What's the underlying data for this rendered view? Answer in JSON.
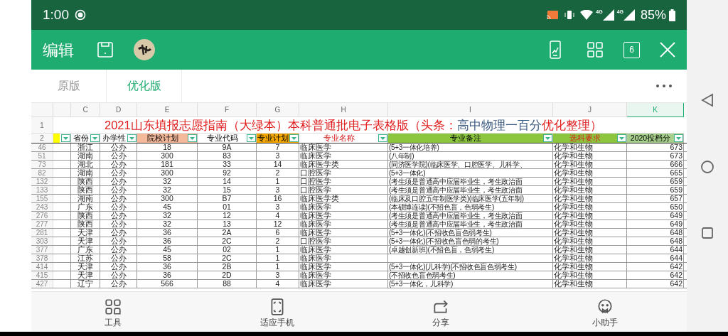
{
  "status_bar": {
    "time": "1:00",
    "network": [
      "4G",
      "4G"
    ],
    "battery": "85%"
  },
  "toolbar": {
    "title": "编辑",
    "page_count": "6"
  },
  "tabs": [
    {
      "label": "原版",
      "selected": false
    },
    {
      "label": "优化版",
      "selected": true
    }
  ],
  "sheet": {
    "columns": [
      {
        "label": "C",
        "selected": false
      },
      {
        "label": "D",
        "selected": false
      },
      {
        "label": "E",
        "selected": false
      },
      {
        "label": "F",
        "selected": false
      },
      {
        "label": "G",
        "selected": false
      },
      {
        "label": "H",
        "selected": false
      },
      {
        "label": "I",
        "selected": false
      },
      {
        "label": "J",
        "selected": false
      },
      {
        "label": "K",
        "selected": true
      }
    ],
    "title_row": "1",
    "title_parts": [
      {
        "text": "2021山东填报志愿指南（大绿本）本科普通批电子表格版（头条：",
        "color": "#e02020"
      },
      {
        "text": "高中物理一百分",
        "color": "#3a5a80"
      },
      {
        "text": "优化整理）",
        "color": "#e02020"
      }
    ],
    "header_row": "2",
    "headers": [
      {
        "color": "#ffff00",
        "kind": "plain"
      },
      {
        "text": "省份",
        "color": "#ffffff",
        "kind": "plain"
      },
      {
        "text": "办学性",
        "color": "#ffffff",
        "kind": "plain"
      },
      {
        "text": "院校计划",
        "color": "#f4b89a",
        "kind": "plain"
      },
      {
        "text": "专业代码",
        "color": "#ffffff",
        "kind": "plain"
      },
      {
        "text": "专业计划",
        "color": "#f5a800",
        "kind": "plain"
      },
      {
        "text": "专业名称",
        "color": "#ffffff",
        "kind": "accent"
      },
      {
        "text": "专业备注",
        "color": "#8cc63f",
        "kind": "plain"
      },
      {
        "text": "选科要求",
        "color": "#8cc63f",
        "kind": "accent"
      },
      {
        "text": "2020投档分",
        "color": "#a8d08d",
        "kind": "plain"
      }
    ],
    "rows": [
      {
        "row": "46",
        "cells": [
          "浙江",
          "公办",
          "18",
          "9A",
          "7",
          "临床医学",
          "(5+3一体化培养)",
          "化学和生物",
          "673"
        ]
      },
      {
        "row": "51",
        "cells": [
          "湖南",
          "公办",
          "300",
          "83",
          "3",
          "临床医学",
          "(八年制)",
          "化学和生物",
          "673"
        ]
      },
      {
        "row": "73",
        "cells": [
          "湖北",
          "公办",
          "181",
          "33",
          "14",
          "临床医学类",
          "(同济医学院)(临床医学、口腔医学、儿科学、",
          "化学和生物",
          "666"
        ]
      },
      {
        "row": "82",
        "cells": [
          "湖南",
          "公办",
          "300",
          "92",
          "2",
          "口腔医学",
          "(5+3一体化)",
          "化学和生物",
          "665"
        ]
      },
      {
        "row": "132",
        "cells": [
          "陕西",
          "公办",
          "32",
          "14",
          "1",
          "口腔医学",
          "(考生须是普通高中应届毕业生，考生政治面",
          "化学和生物",
          "659"
        ]
      },
      {
        "row": "133",
        "cells": [
          "陕西",
          "公办",
          "32",
          "15",
          "3",
          "口腔医学",
          "(考生须是普通高中应届毕业生，考生政治面",
          "化学和生物",
          "659"
        ]
      },
      {
        "row": "155",
        "cells": [
          "湖南",
          "公办",
          "300",
          "B7",
          "16",
          "临床医学类",
          "(临床及口腔五年制医学类)(临床医学(五年制)",
          "化学和生物",
          "657"
        ]
      },
      {
        "row": "243",
        "cells": [
          "广东",
          "公办",
          "45",
          "01",
          "3",
          "临床医学",
          "(本硕博连读)(不招色盲，色弱考生)",
          "化学和生物",
          "650"
        ]
      },
      {
        "row": "276",
        "cells": [
          "陕西",
          "公办",
          "32",
          "12",
          "4",
          "临床医学",
          "(考生须是普通高中应届毕业生，考生政治面",
          "化学和生物",
          "649"
        ]
      },
      {
        "row": "277",
        "cells": [
          "陕西",
          "公办",
          "32",
          "13",
          "12",
          "临床医学",
          "(考生须是普通高中应届毕业生，考生政治面",
          "化学和生物",
          "649"
        ]
      },
      {
        "row": "281",
        "cells": [
          "天津",
          "公办",
          "36",
          "2A",
          "6",
          "临床医学",
          "(5+3一体化)(不招收色盲色弱考生)",
          "化学和生物",
          "648"
        ]
      },
      {
        "row": "303",
        "cells": [
          "天津",
          "公办",
          "36",
          "2C",
          "2",
          "口腔医学",
          "(5+3一体化)(不招收色盲色弱的考生)",
          "化学和生物",
          "648"
        ]
      },
      {
        "row": "377",
        "cells": [
          "广东",
          "公办",
          "45",
          "02",
          "1",
          "临床医学",
          "(卓越创新班)(不招色盲，色弱考生)",
          "化学和生物",
          "644"
        ]
      },
      {
        "row": "378",
        "cells": [
          "江苏",
          "公办",
          "58",
          "2C",
          "1",
          "临床医学",
          null,
          "化学和生物",
          "644"
        ]
      },
      {
        "row": "414",
        "cells": [
          "天津",
          "公办",
          "36",
          "2B",
          "1",
          "临床医学",
          "(5+3一体化)(儿科学)(不招收色盲色弱考生)",
          "化学和生物",
          "642"
        ]
      },
      {
        "row": "415",
        "cells": [
          "天津",
          "公办",
          "36",
          "2D",
          "3",
          "临床医学",
          "(不招收色盲色弱考生)",
          "化学和生物",
          "642"
        ]
      },
      {
        "row": "427",
        "cells": [
          "辽宁",
          "公办",
          "566",
          "88",
          "4",
          "临床医学",
          "(5+3一体化，儿科学)",
          "化学和生物",
          "642"
        ]
      }
    ]
  },
  "bottom_bar": [
    {
      "label": "工具",
      "kind": "tools"
    },
    {
      "label": "适应手机",
      "kind": "fit"
    },
    {
      "label": "分享",
      "kind": "share"
    },
    {
      "label": "小助手",
      "kind": "assistant"
    }
  ]
}
